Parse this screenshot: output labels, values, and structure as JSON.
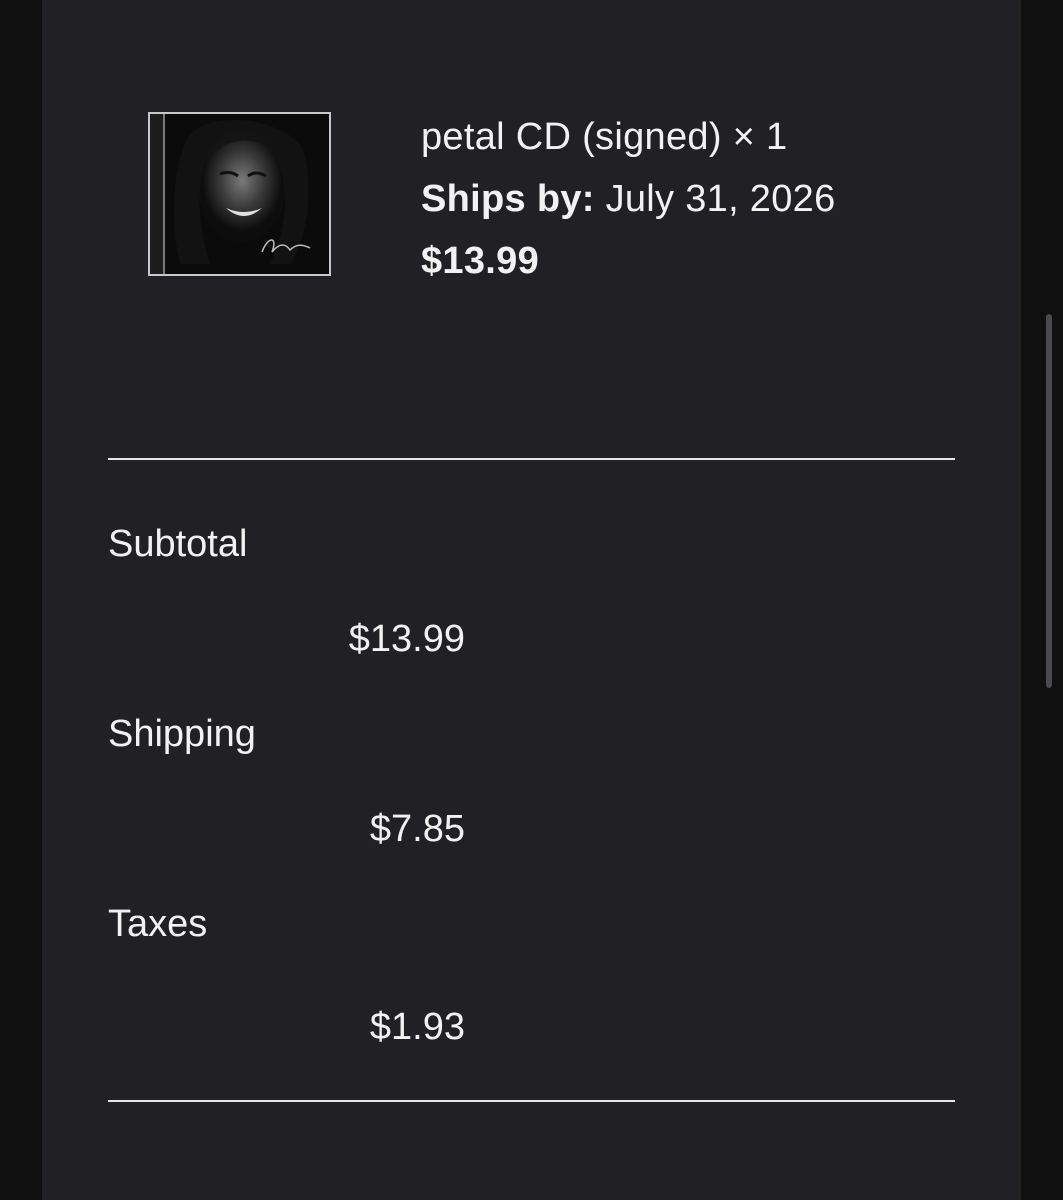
{
  "item": {
    "title": "petal CD (signed) × 1",
    "ships_label": "Ships by:",
    "ships_date": "July 31, 2026",
    "price": "$13.99",
    "thumbnail_icon": "album-cover-image"
  },
  "summary": {
    "subtotal_label": "Subtotal",
    "subtotal_value": "$13.99",
    "shipping_label": "Shipping",
    "shipping_value": "$7.85",
    "taxes_label": "Taxes",
    "taxes_value": "$1.93"
  },
  "colors": {
    "page_background": "#101011",
    "panel_background": "#212125",
    "text": "#f2f2f2",
    "divider": "#e6e6e6"
  }
}
